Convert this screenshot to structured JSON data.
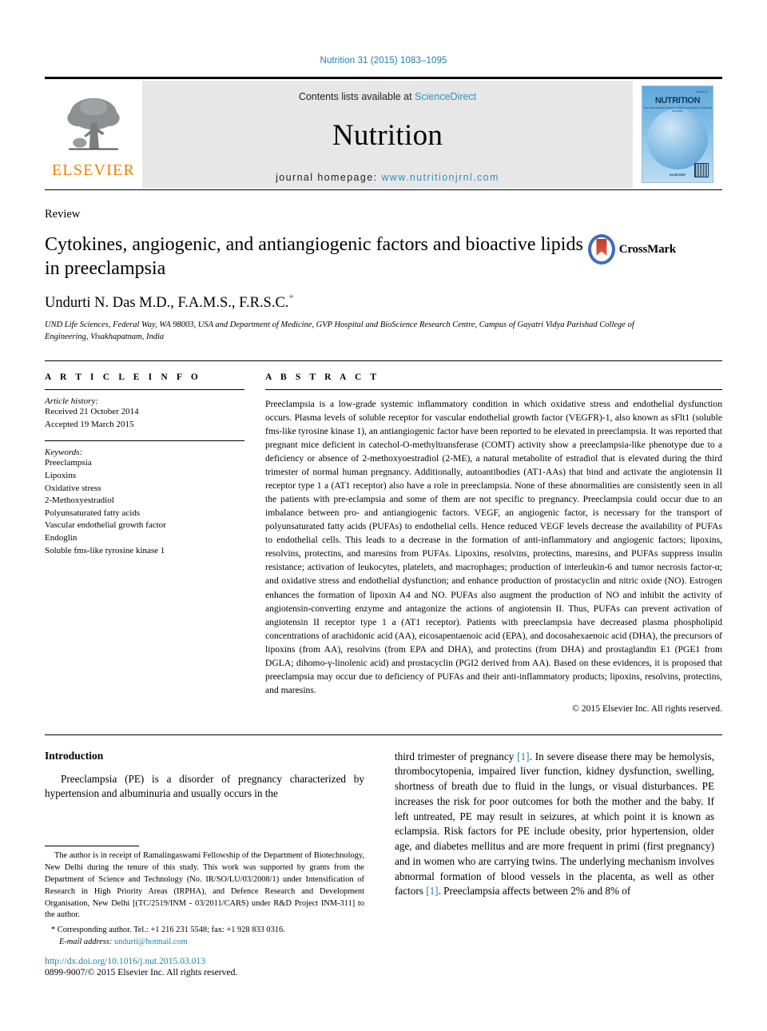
{
  "running_head": "Nutrition 31 (2015) 1083–1095",
  "masthead": {
    "publisher_name": "ELSEVIER",
    "contents_prefix": "Contents lists available at ",
    "contents_link": "ScienceDirect",
    "journal_name": "Nutrition",
    "homepage_prefix": "journal homepage: ",
    "homepage_url": "www.nutritionjrnl.com",
    "cover": {
      "volume": "Volume 31",
      "title": "NUTRITION",
      "subtitle": "The International Journal of Applied and Basic Nutritional Sciences",
      "publisher": "ELSEVIER"
    }
  },
  "article": {
    "kind": "Review",
    "title": "Cytokines, angiogenic, and antiangiogenic factors and bioactive lipids in preeclampsia",
    "crossmark_label": "CrossMark",
    "authors": "Undurti N. Das M.D., F.A.M.S., F.R.S.C.",
    "corresponding_marker": "*",
    "affiliation": "UND Life Sciences, Federal Way, WA 98003, USA and Department of Medicine, GVP Hospital and BioScience Research Centre, Campus of Gayatri Vidya Parishad College of Engineering, Visakhapatnam, India"
  },
  "article_info": {
    "label": "A R T I C L E   I N F O",
    "history_head": "Article history:",
    "history_lines": [
      "Received 21 October 2014",
      "Accepted 19 March 2015"
    ],
    "keywords_head": "Keywords:",
    "keywords": [
      "Preeclampsia",
      "Lipoxins",
      "Oxidative stress",
      "2-Methoxyestradiol",
      "Polyunsaturated fatty acids",
      "Vascular endothelial growth factor",
      "Endoglin",
      "Soluble fms-like tyrosine kinase 1"
    ]
  },
  "abstract": {
    "label": "A B S T R A C T",
    "text": "Preeclampsia is a low-grade systemic inflammatory condition in which oxidative stress and endothelial dysfunction occurs. Plasma levels of soluble receptor for vascular endothelial growth factor (VEGFR)-1, also known as sFlt1 (soluble fms-like tyrosine kinase 1), an antiangiogenic factor have been reported to be elevated in preeclampsia. It was reported that pregnant mice deficient in catechol-O-methyltransferase (COMT) activity show a preeclampsia-like phenotype due to a deficiency or absence of 2-methoxyoestradiol (2-ME), a natural metabolite of estradiol that is elevated during the third trimester of normal human pregnancy. Additionally, autoantibodies (AT1-AAs) that bind and activate the angiotensin II receptor type 1 a (AT1 receptor) also have a role in preeclampsia. None of these abnormalities are consistently seen in all the patients with pre-eclampsia and some of them are not specific to pregnancy. Preeclampsia could occur due to an imbalance between pro- and antiangiogenic factors. VEGF, an angiogenic factor, is necessary for the transport of polyunsaturated fatty acids (PUFAs) to endothelial cells. Hence reduced VEGF levels decrease the availability of PUFAs to endothelial cells. This leads to a decrease in the formation of anti-inflammatory and angiogenic factors; lipoxins, resolvins, protectins, and maresins from PUFAs. Lipoxins, resolvins, protectins, maresins, and PUFAs suppress insulin resistance; activation of leukocytes, platelets, and macrophages; production of interleukin-6 and tumor necrosis factor-α; and oxidative stress and endothelial dysfunction; and enhance production of prostacyclin and nitric oxide (NO). Estrogen enhances the formation of lipoxin A4 and NO. PUFAs also augment the production of NO and inhibit the activity of angiotensin-converting enzyme and antagonize the actions of angiotensin II. Thus, PUFAs can prevent activation of angiotensin II receptor type 1 a (AT1 receptor). Patients with preeclampsia have decreased plasma phospholipid concentrations of arachidonic acid (AA), eicosapentaenoic acid (EPA), and docosahexaenoic acid (DHA), the precursors of lipoxins (from AA), resolvins (from EPA and DHA), and protectins (from DHA) and prostaglandin E1 (PGE1 from DGLA; dihomo-γ-linolenic acid) and prostacyclin (PGI2 derived from AA). Based on these evidences, it is proposed that preeclampsia may occur due to deficiency of PUFAs and their anti-inflammatory products; lipoxins, resolvins, protectins, and maresins.",
    "copyright": "© 2015 Elsevier Inc. All rights reserved."
  },
  "body": {
    "section_heading": "Introduction",
    "left_paragraph": "Preeclampsia (PE) is a disorder of pregnancy characterized by hypertension and albuminuria and usually occurs in the",
    "right_paragraph_pre": "third trimester of pregnancy ",
    "right_ref_1": "[1]",
    "right_paragraph_mid": ". In severe disease there may be hemolysis, thrombocytopenia, impaired liver function, kidney dysfunction, swelling, shortness of breath due to fluid in the lungs, or visual disturbances. PE increases the risk for poor outcomes for both the mother and the baby. If left untreated, PE may result in seizures, at which point it is known as eclampsia. Risk factors for PE include obesity, prior hypertension, older age, and diabetes mellitus and are more frequent in primi (first pregnancy) and in women who are carrying twins. The underlying mechanism involves abnormal formation of blood vessels in the placenta, as well as other factors ",
    "right_ref_2": "[1]",
    "right_paragraph_post": ". Preeclampsia affects between 2% and 8% of"
  },
  "footnotes": {
    "funding": "The author is in receipt of Ramalingaswami Fellowship of the Department of Biotechnology, New Delhi during the tenure of this study. This work was supported by grants from the Department of Science and Technology (No. IR/SO/LU/03/2008/1) under Intensification of Research in High Priority Areas (IRPHA), and Defence Research and Development Organisation, New Delhi [(TC/2519/INM - 03/2011/CARS) under R&D Project INM-311] to the author.",
    "corresponding": "* Corresponding author. Tel.: +1 216 231 5548; fax: +1 928 833 0316.",
    "email_label": "E-mail address:",
    "email": "undurti@hotmail.com"
  },
  "footer": {
    "doi": "http://dx.doi.org/10.1016/j.nut.2015.03.013",
    "issn_line": "0899-9007/© 2015 Elsevier Inc. All rights reserved."
  }
}
